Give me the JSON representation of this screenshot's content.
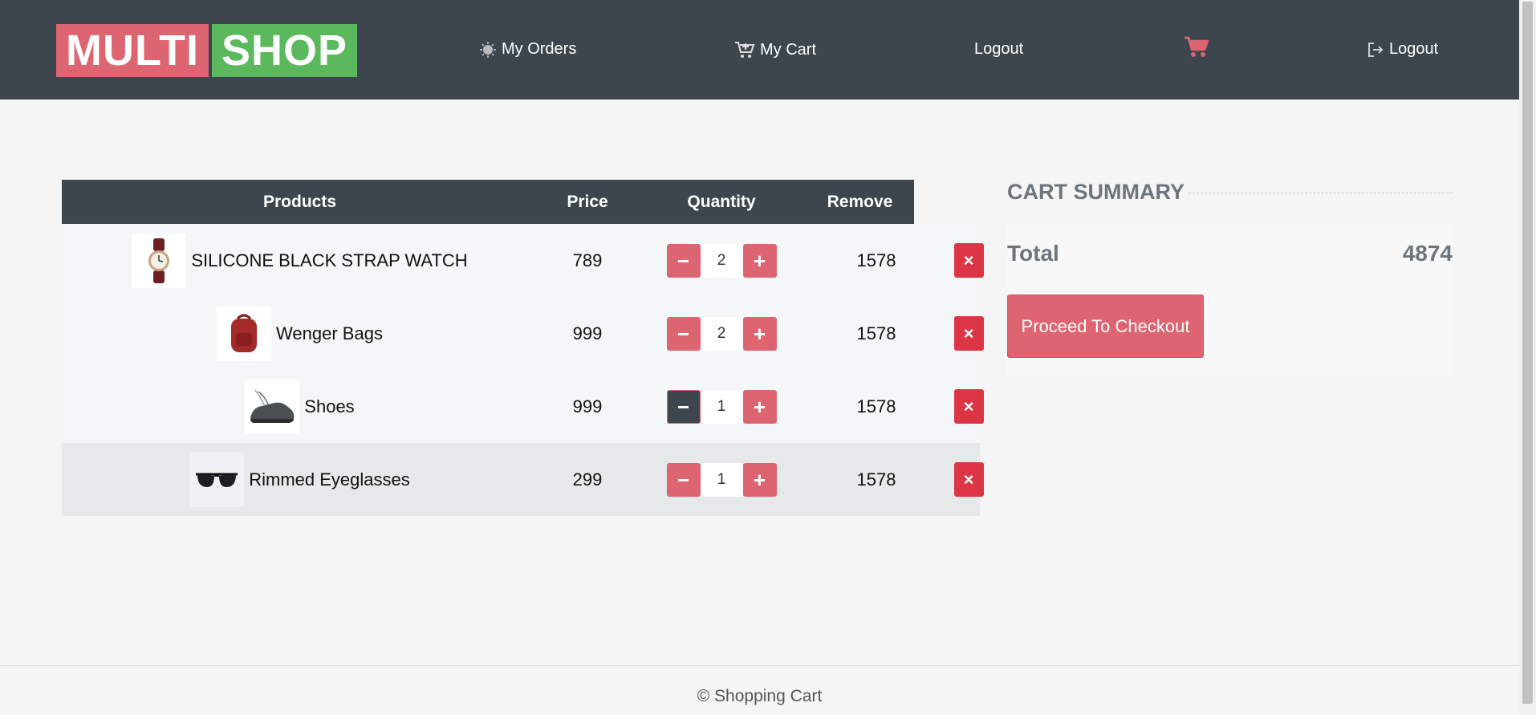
{
  "header": {
    "logo_part1": "MULTI",
    "logo_part2": "SHOP",
    "nav": {
      "orders": "My Orders",
      "cart": "My Cart",
      "logout1": "Logout",
      "logout2": "Logout"
    }
  },
  "table": {
    "headers": [
      "Products",
      "Price",
      "Quantity",
      "Remove"
    ],
    "rows": [
      {
        "name": "SILICONE BLACK STRAP WATCH",
        "price": "789",
        "qty": "2",
        "total": "1578",
        "thumb": "watch"
      },
      {
        "name": "Wenger Bags",
        "price": "999",
        "qty": "2",
        "total": "1578",
        "thumb": "bag"
      },
      {
        "name": "Shoes",
        "price": "999",
        "qty": "1",
        "total": "1578",
        "thumb": "shoe"
      },
      {
        "name": "Rimmed Eyeglasses",
        "price": "299",
        "qty": "1",
        "total": "1578",
        "thumb": "glasses"
      }
    ],
    "minus": "−",
    "plus": "+",
    "remove": "×"
  },
  "summary": {
    "title": "CART SUMMARY",
    "total_label": "Total",
    "total_value": "4874",
    "checkout": "Proceed To Checkout"
  },
  "footer": {
    "text": "© Shopping Cart"
  },
  "colors": {
    "brand_primary": "#dd6572",
    "brand_secondary": "#5cb85c",
    "header_bg": "#3d464d",
    "danger": "#dc3545"
  }
}
